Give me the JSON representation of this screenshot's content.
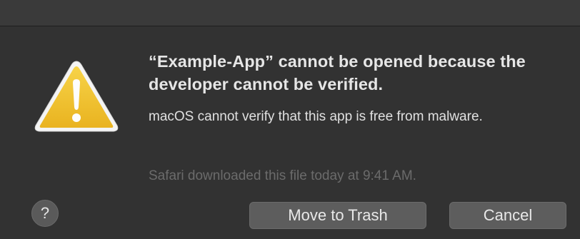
{
  "dialog": {
    "title": "“Example-App” cannot be opened because the developer cannot be verified.",
    "message": "macOS cannot verify that this app is free from malware.",
    "info": "Safari downloaded this file today at 9:41 AM.",
    "icon": "warning-icon"
  },
  "buttons": {
    "help_label": "?",
    "move_to_trash_label": "Move to Trash",
    "cancel_label": "Cancel"
  },
  "colors": {
    "background": "#323232",
    "warning_yellow": "#f0c22e",
    "button": "#5d5d5d",
    "secondary_text": "#6b6b6b"
  }
}
